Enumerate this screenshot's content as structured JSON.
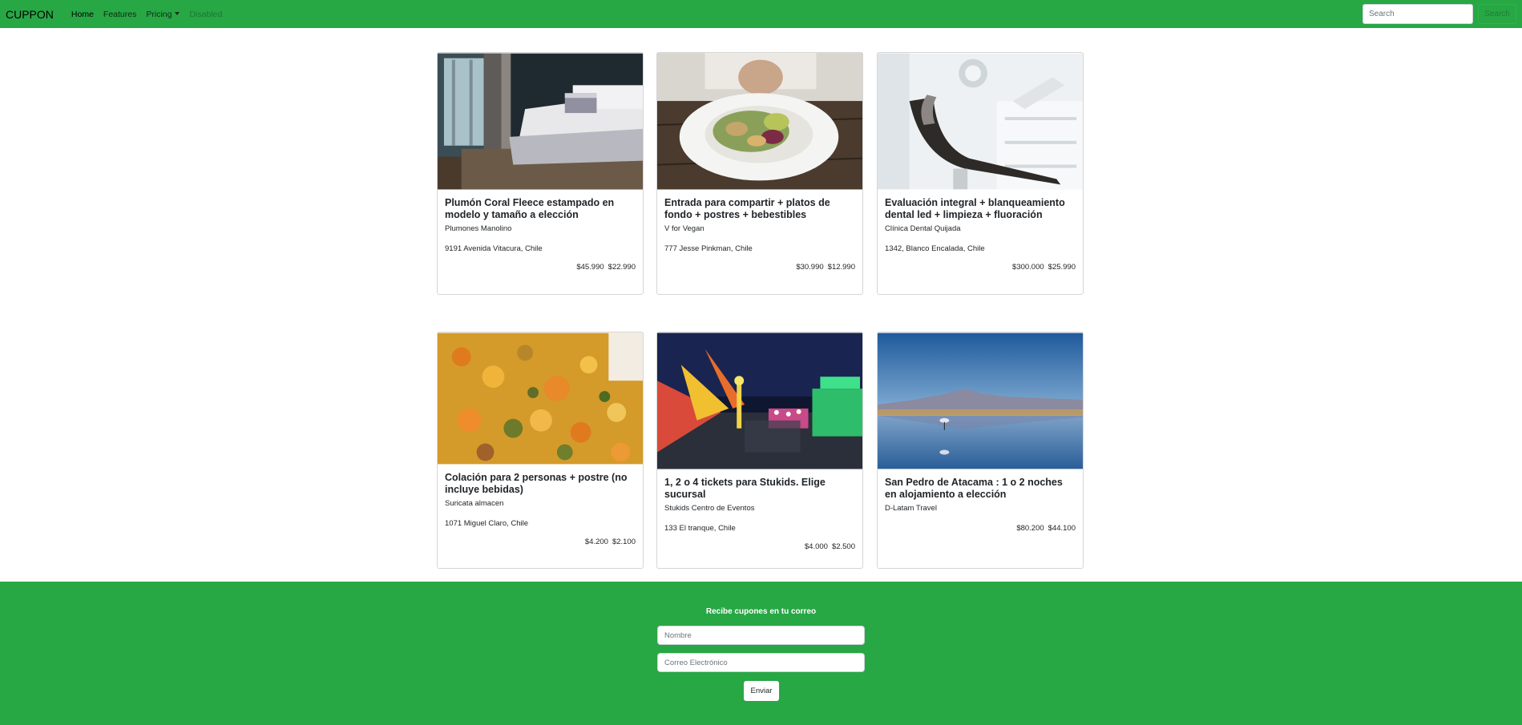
{
  "navbar": {
    "brand": "CUPPON",
    "links": [
      "Home",
      "Features",
      "Pricing",
      "Disabled"
    ],
    "search_placeholder": "Search",
    "search_button": "Search"
  },
  "cards": [
    {
      "title": "Plumón Coral Fleece estampado en modelo y tamaño a elección",
      "vendor": "Plumones Manolino",
      "address": "9191 Avenida Vitacura, Chile",
      "price_old": "$45.990",
      "price_new": "$22.990",
      "image": "bedroom-photo"
    },
    {
      "title": "Entrada para compartir + platos de fondo + postres + bebestibles",
      "vendor": "V for Vegan",
      "address": "777 Jesse Pinkman, Chile",
      "price_old": "$30.990",
      "price_new": "$12.990",
      "image": "salad-plate-photo"
    },
    {
      "title": "Evaluación integral + blanqueamiento dental led + limpieza + fluoración",
      "vendor": "Clínica Dental Quijada",
      "address": "1342, Blanco Encalada, Chile",
      "price_old": "$300.000",
      "price_new": "$25.990",
      "image": "dental-chair-photo"
    },
    {
      "title": "Colación para 2 personas + postre (no incluye bebidas)",
      "vendor": "Suricata almacen",
      "address": "1071 Miguel Claro, Chile",
      "price_old": "$4.200",
      "price_new": "$2.100",
      "image": "food-dish-photo"
    },
    {
      "title": "1, 2 o 4 tickets para Stukids. Elige sucursal",
      "vendor": "Stukids Centro de Eventos",
      "address": "133 El tranque, Chile",
      "price_old": "$4.000",
      "price_new": "$2.500",
      "image": "fairground-night-photo"
    },
    {
      "title": "San Pedro de Atacama : 1 o 2 noches en alojamiento a elección",
      "vendor": "D-Latam Travel",
      "address": "",
      "price_old": "$80.200",
      "price_new": "$44.100",
      "image": "atacama-lagoon-photo"
    }
  ],
  "footer": {
    "title": "Recibe cupones en tu correo",
    "name_placeholder": "Nombre",
    "email_placeholder": "Correo Electrónico",
    "submit_label": "Enviar"
  },
  "colors": {
    "brand_green": "#28a745"
  }
}
